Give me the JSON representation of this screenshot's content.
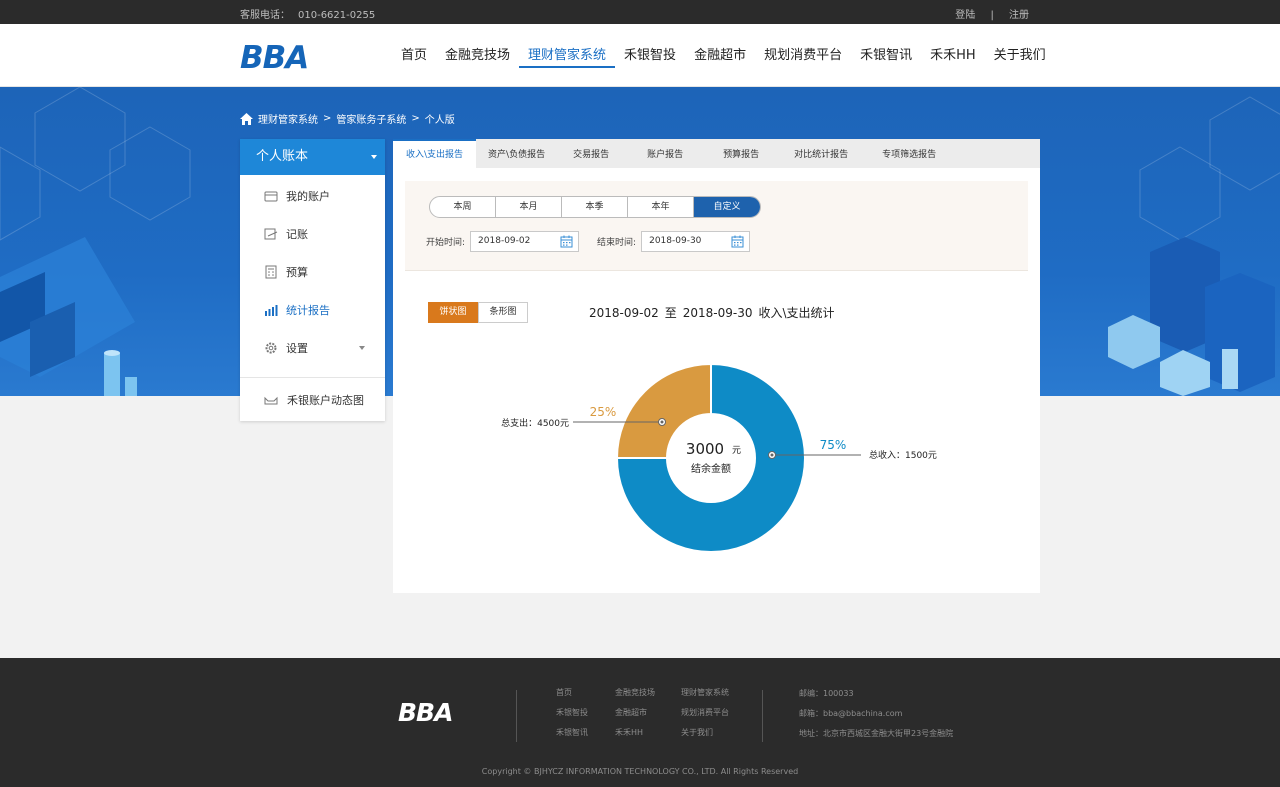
{
  "topbar": {
    "phone_label": "客服电话：",
    "phone": "010-6621-0255",
    "login": "登陆",
    "separator": "|",
    "register": "注册"
  },
  "header": {
    "logo": "BBA",
    "nav": [
      "首页",
      "金融竞技场",
      "理财管家系统",
      "禾银智投",
      "金融超市",
      "规划消费平台",
      "禾银智讯",
      "禾禾HH",
      "关于我们"
    ],
    "active_nav": "理财管家系统"
  },
  "breadcrumb": {
    "items": [
      "理财管家系统",
      "管家账务子系统",
      "个人版"
    ],
    "separator": ">"
  },
  "sidebar": {
    "title": "个人账本",
    "items": [
      {
        "label": "我的账户",
        "icon": "card-icon"
      },
      {
        "label": "记账",
        "icon": "edit-icon"
      },
      {
        "label": "预算",
        "icon": "calculator-icon"
      },
      {
        "label": "统计报告",
        "icon": "bar-chart-icon"
      },
      {
        "label": "设置",
        "icon": "gear-icon"
      }
    ],
    "active_item": "统计报告",
    "footer_item": "禾银账户动态图"
  },
  "tabs": [
    "收入\\支出报告",
    "资产\\负债报告",
    "交易报告",
    "账户报告",
    "预算报告",
    "对比统计报告",
    "专项筛选报告"
  ],
  "active_tab": "收入\\支出报告",
  "period": {
    "options": [
      "本周",
      "本月",
      "本季",
      "本年",
      "自定义"
    ],
    "selected": "自定义"
  },
  "dates": {
    "start_label": "开始时间:",
    "start_value": "2018-09-02",
    "end_label": "结束时间:",
    "end_value": "2018-09-30"
  },
  "chart_toggle": {
    "options": [
      "饼状图",
      "条形图"
    ],
    "selected": "饼状图"
  },
  "chart_title": {
    "start": "2018-09-02",
    "to": "至",
    "end": "2018-09-30",
    "suffix": "收入\\支出统计"
  },
  "chart_data": {
    "type": "pie",
    "donut": true,
    "categories": [
      "总支出",
      "总收入"
    ],
    "values": [
      25,
      75
    ],
    "value_labels": [
      "25%",
      "75%"
    ],
    "callouts": [
      "总支出：4500元",
      "总收入：1500元"
    ],
    "colors": [
      "#d99a40",
      "#0e8bc6"
    ],
    "center_value": "3000",
    "center_unit": "元",
    "center_label": "结余金额"
  },
  "footer": {
    "logo": "BBA",
    "links": [
      "首页",
      "金融竞技场",
      "理财管家系统",
      "禾银智投",
      "金融超市",
      "规划消费平台",
      "禾银智讯",
      "禾禾HH",
      "关于我们"
    ],
    "postcode": "邮编：100033",
    "email": "邮箱：bba@bbachina.com",
    "address": "地址：北京市西城区金融大街甲23号金融院",
    "copyright": "Copyright © BJHYCZ INFORMATION TECHNOLOGY CO., LTD. All Rights Reserved"
  },
  "colors": {
    "brand_blue": "#1a6fc4",
    "accent_orange": "#d9791c",
    "banner_blue": "#1d64b8"
  }
}
